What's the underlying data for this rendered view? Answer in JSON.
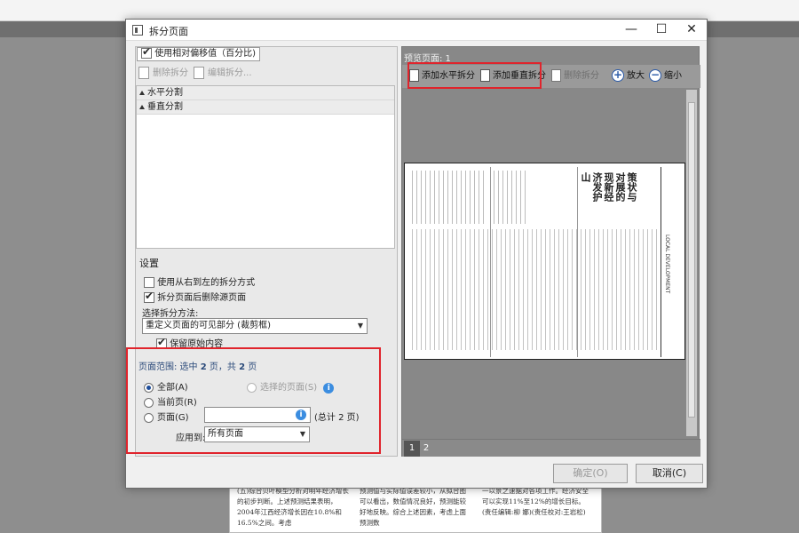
{
  "dialog": {
    "title": "拆分页面",
    "window_controls": {
      "minimize": "—",
      "maximize": "☐",
      "close": "✕"
    },
    "options": {
      "relative_offset": {
        "label": "使用相对偏移值（百分比)",
        "checked": true
      }
    },
    "left_toolbar": {
      "delete": "删除拆分",
      "edit": "编辑拆分..."
    },
    "split_list": [
      "水平分割",
      "垂直分割"
    ],
    "settings": {
      "header": "设置",
      "rtl": {
        "label": "使用从右到左的拆分方式",
        "checked": false
      },
      "delete_source": {
        "label": "拆分页面后删除源页面",
        "checked": true
      },
      "method_label": "选择拆分方法:",
      "method_value": "重定义页面的可见部分 (裁剪框)",
      "keep_original": {
        "label": "保留原始内容",
        "checked": true
      }
    },
    "page_range": {
      "header_prefix": "页面范围: 选中 ",
      "selected": "2",
      "header_mid": " 页，共 ",
      "total": "2",
      "header_suffix": " 页",
      "options": {
        "all": {
          "label": "全部(A)",
          "selected": true
        },
        "selected_pages": {
          "label": "选择的页面(S)",
          "enabled": false
        },
        "current": {
          "label": "当前页(R)",
          "selected": false
        },
        "pages": {
          "label": "页面(G)",
          "selected": false
        }
      },
      "pages_input_value": "",
      "total_note": "(总计 2 页)",
      "apply_label": "应用到:",
      "apply_value": "所有页面"
    },
    "preview": {
      "title": "预览页面: 1",
      "toolbar": {
        "add_horizontal": "添加水平拆分",
        "add_vertical": "添加垂直拆分",
        "delete": "删除拆分",
        "zoom_in": "放大",
        "zoom_out": "缩小"
      },
      "page_tabs": [
        "1",
        "2"
      ],
      "active_tab": "1",
      "doc_title_lines": [
        "护山",
        "新经济发",
        "展的现",
        "状与对",
        "策"
      ],
      "side_label": "LOCAL DEVELOPMENT"
    },
    "buttons": {
      "ok": "确定(O)",
      "cancel": "取消(C)"
    },
    "highlight_color": "#e0242c"
  },
  "background_doc": {
    "col1": "(五)综合贝叶模型分析对明年经济增长的初步判断。上述预测结果表明，2004年江西经济增长因在10.8%和16.5%之间。考虑",
    "col2": "预测值与实际值误差较小，从拟合图可以看出，数值情况良好，预测能较好地反映。综合上述因素，考虑上面预测数",
    "col3": "一以景之速据对各项工作。经济安全可以实现11%至12%的增长目标。(责任编辑:柳 娜)(责任校对:王岩松)"
  }
}
